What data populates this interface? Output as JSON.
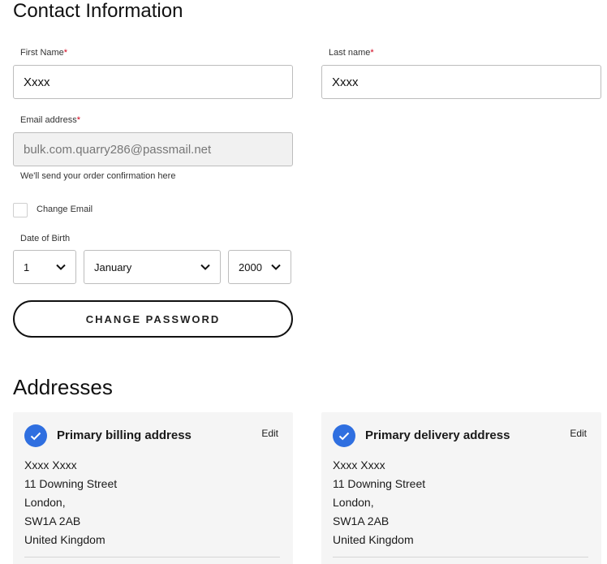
{
  "contact": {
    "heading": "Contact Information",
    "first_name": {
      "label": "First Name",
      "required_mark": "*",
      "value": "Xxxx"
    },
    "last_name": {
      "label": "Last name",
      "required_mark": "*",
      "value": "Xxxx"
    },
    "email": {
      "label": "Email address",
      "required_mark": "*",
      "value": "bulk.com.quarry286@passmail.net",
      "helper": "We'll send your order confirmation here"
    },
    "change_email": {
      "label": "Change Email",
      "checked": false
    },
    "dob": {
      "label": "Date of Birth",
      "day": "1",
      "month": "January",
      "year": "2000"
    },
    "change_password_label": "CHANGE PASSWORD"
  },
  "addresses": {
    "heading": "Addresses",
    "cards": [
      {
        "title": "Primary billing address",
        "edit_label": "Edit",
        "lines": [
          "Xxxx Xxxx",
          "11 Downing Street",
          "London,",
          "SW1A 2AB",
          "United Kingdom"
        ]
      },
      {
        "title": "Primary delivery address",
        "edit_label": "Edit",
        "lines": [
          "Xxxx Xxxx",
          "11 Downing Street",
          "London,",
          "SW1A 2AB",
          "United Kingdom"
        ]
      }
    ]
  },
  "colors": {
    "accent": "#2f6fe0",
    "required": "#d0021b",
    "card_bg": "#f5f5f5"
  }
}
